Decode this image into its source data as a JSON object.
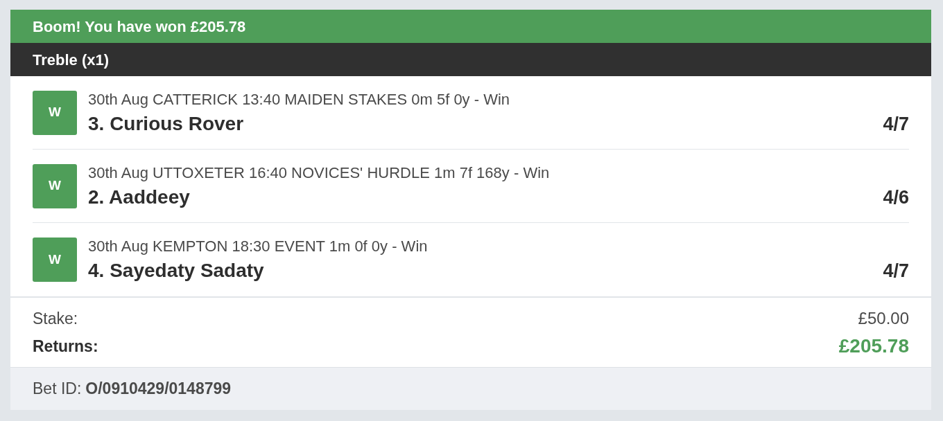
{
  "banner": {
    "text": "Boom! You have won £205.78"
  },
  "bet_type": {
    "text": "Treble (x1)"
  },
  "selections": [
    {
      "result": "W",
      "won": true,
      "event": "30th Aug CATTERICK 13:40 MAIDEN STAKES 0m 5f 0y - Win",
      "runner": "3. Curious Rover",
      "odds": "4/7"
    },
    {
      "result": "W",
      "won": true,
      "event": "30th Aug UTTOXETER 16:40 NOVICES' HURDLE 1m 7f 168y - Win",
      "runner": "2. Aaddeey",
      "odds": "4/6"
    },
    {
      "result": "W",
      "won": true,
      "event": "30th Aug KEMPTON 18:30 EVENT 1m 0f 0y - Win",
      "runner": "4. Sayedaty Sadaty",
      "odds": "4/7"
    }
  ],
  "summary": {
    "stake_label": "Stake:",
    "stake": "£50.00",
    "returns_label": "Returns:",
    "returns": "£205.78"
  },
  "footer": {
    "bet_id_label": "Bet ID:",
    "bet_id": "O/0910429/0148799"
  }
}
